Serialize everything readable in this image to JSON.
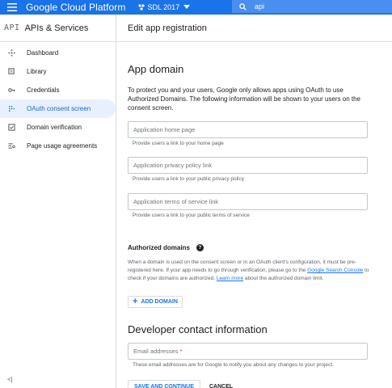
{
  "topbar": {
    "brand": "Google Cloud Platform",
    "project": "SDL 2017",
    "search_value": "api"
  },
  "sidebar": {
    "logo": "API",
    "title": "APIs & Services",
    "items": [
      {
        "label": "Dashboard",
        "icon": "dashboard-icon"
      },
      {
        "label": "Library",
        "icon": "library-icon"
      },
      {
        "label": "Credentials",
        "icon": "key-icon"
      },
      {
        "label": "OAuth consent screen",
        "icon": "consent-icon",
        "active": true
      },
      {
        "label": "Domain verification",
        "icon": "check-box-icon"
      },
      {
        "label": "Page usage agreements",
        "icon": "settings-list-icon"
      }
    ],
    "collapse": "<|"
  },
  "main": {
    "header": "Edit app registration",
    "app_domain": {
      "title": "App domain",
      "description": "To protect you and your users, Google only allows apps using OAuth to use Authorized Domains. The following information will be shown to your users on the consent screen.",
      "fields": [
        {
          "placeholder": "Application home page",
          "hint": "Provide users a link to your home page"
        },
        {
          "placeholder": "Application privacy policy link",
          "hint": "Provide users a link to your public privacy policy"
        },
        {
          "placeholder": "Application terms of service link",
          "hint": "Provide users a link to your public terms of service"
        }
      ]
    },
    "authorized_domains": {
      "title": "Authorized domains",
      "desc_part1": "When a domain is used on the consent screen or in an OAuth client's configuration, it must be pre-registered here. If your app needs to go through verification, please go to the ",
      "link1": "Google Search Console",
      "desc_part2": " to check if your domains are authorized. ",
      "link2": "Learn more",
      "desc_part3": " about the authorized domain limit.",
      "add_button": "ADD DOMAIN"
    },
    "developer_contact": {
      "title": "Developer contact information",
      "email_placeholder": "Email addresses",
      "required_mark": "*",
      "hint": "These email addresses are for Google to notify you about any changes to your project."
    },
    "actions": {
      "save": "SAVE AND CONTINUE",
      "cancel": "CANCEL"
    }
  }
}
